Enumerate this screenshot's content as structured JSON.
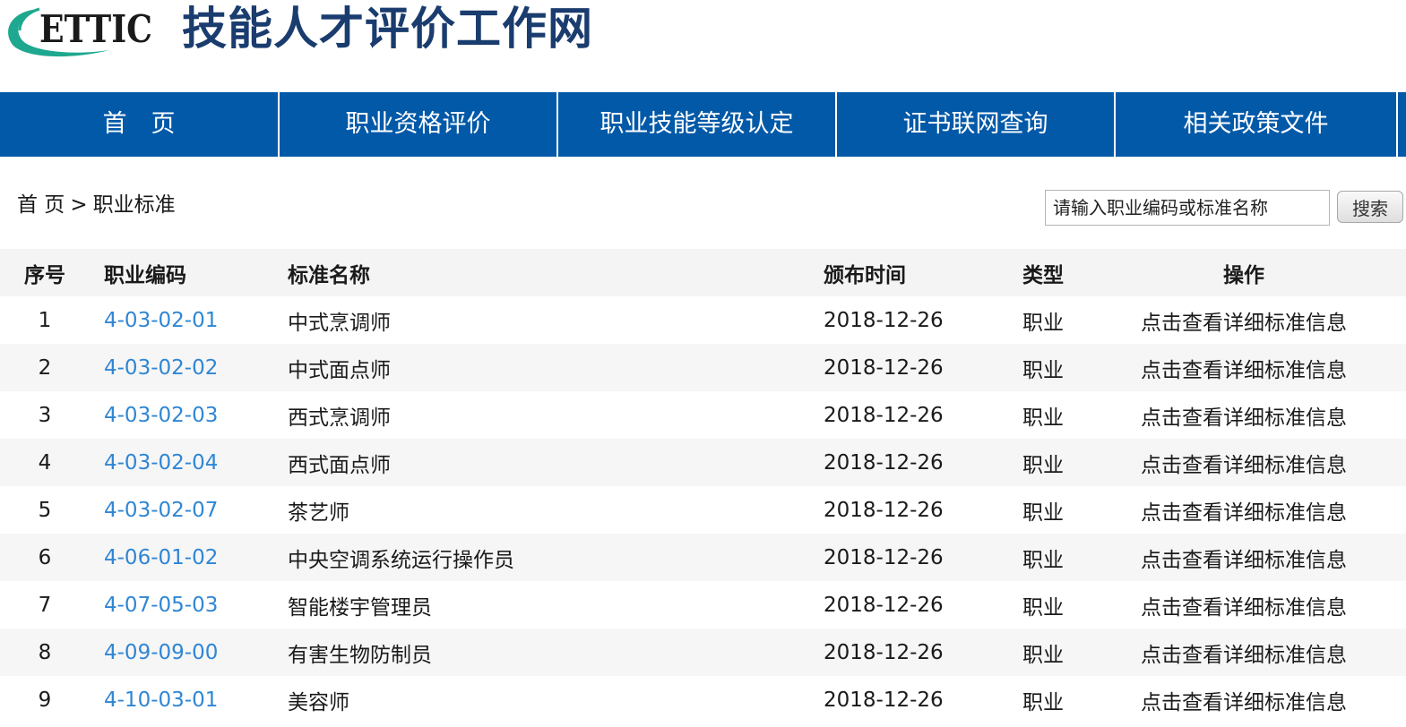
{
  "header": {
    "logo_text": "ETTIC",
    "site_title": "技能人才评价工作网",
    "brand_color": "#0259a8",
    "logo_accent_color": "#1ea88f"
  },
  "nav": {
    "items": [
      {
        "label": "首　页"
      },
      {
        "label": "职业资格评价"
      },
      {
        "label": "职业技能等级认定"
      },
      {
        "label": "证书联网查询"
      },
      {
        "label": "相关政策文件"
      }
    ]
  },
  "breadcrumb": {
    "home": "首 页",
    "separator": ">",
    "current": "职业标准"
  },
  "search": {
    "placeholder": "请输入职业编码或标准名称",
    "button_label": "搜索"
  },
  "table": {
    "columns": [
      "序号",
      "职业编码",
      "标准名称",
      "颁布时间",
      "类型",
      "操作"
    ],
    "rows": [
      {
        "idx": "1",
        "code": "4-03-02-01",
        "name": "中式烹调师",
        "date": "2018-12-26",
        "type": "职业",
        "op": "点击查看详细标准信息"
      },
      {
        "idx": "2",
        "code": "4-03-02-02",
        "name": "中式面点师",
        "date": "2018-12-26",
        "type": "职业",
        "op": "点击查看详细标准信息"
      },
      {
        "idx": "3",
        "code": "4-03-02-03",
        "name": "西式烹调师",
        "date": "2018-12-26",
        "type": "职业",
        "op": "点击查看详细标准信息"
      },
      {
        "idx": "4",
        "code": "4-03-02-04",
        "name": "西式面点师",
        "date": "2018-12-26",
        "type": "职业",
        "op": "点击查看详细标准信息"
      },
      {
        "idx": "5",
        "code": "4-03-02-07",
        "name": "茶艺师",
        "date": "2018-12-26",
        "type": "职业",
        "op": "点击查看详细标准信息"
      },
      {
        "idx": "6",
        "code": "4-06-01-02",
        "name": "中央空调系统运行操作员",
        "date": "2018-12-26",
        "type": "职业",
        "op": "点击查看详细标准信息"
      },
      {
        "idx": "7",
        "code": "4-07-05-03",
        "name": "智能楼宇管理员",
        "date": "2018-12-26",
        "type": "职业",
        "op": "点击查看详细标准信息"
      },
      {
        "idx": "8",
        "code": "4-09-09-00",
        "name": "有害生物防制员",
        "date": "2018-12-26",
        "type": "职业",
        "op": "点击查看详细标准信息"
      },
      {
        "idx": "9",
        "code": "4-10-03-01",
        "name": "美容师",
        "date": "2018-12-26",
        "type": "职业",
        "op": "点击查看详细标准信息"
      }
    ]
  }
}
